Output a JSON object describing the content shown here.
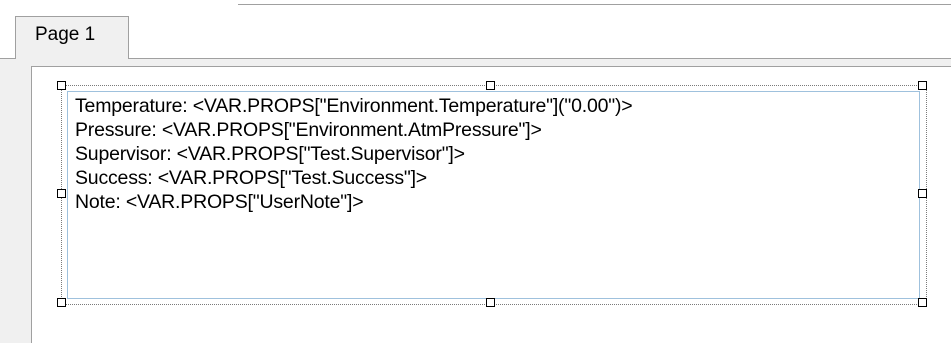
{
  "tabs": [
    {
      "label": "Page 1",
      "selected": true
    }
  ],
  "text_control": {
    "lines": [
      "Temperature: <VAR.PROPS[\"Environment.Temperature\"](\"0.00\")>",
      "Pressure: <VAR.PROPS[\"Environment.AtmPressure\"]>",
      "Supervisor: <VAR.PROPS[\"Test.Supervisor\"]>",
      "Success: <VAR.PROPS[\"Test.Success\"]>",
      "Note: <VAR.PROPS[\"UserNote\"]>"
    ]
  },
  "colors": {
    "panel_bg": "#f0f0f0",
    "border": "#a0a0a0",
    "control_border": "#9fc1dd"
  }
}
